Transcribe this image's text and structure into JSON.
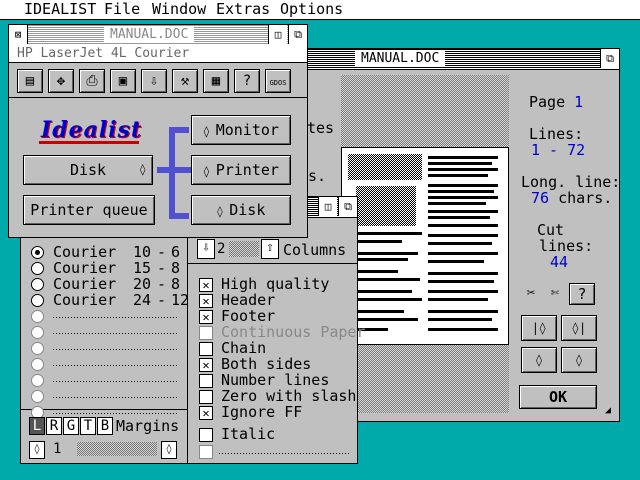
{
  "menu": {
    "items": [
      "IDEALIST",
      "File",
      "Window",
      "Extras",
      "Options"
    ]
  },
  "manual_window": {
    "title": "MANUAL.DOC",
    "page_label": "Page",
    "page_value": "1",
    "lines_label": "Lines:",
    "lines_value": "1 - 72",
    "long_label": "Long. line:",
    "long_value": "76",
    "long_unit": "chars.",
    "cut_label1": "Cut",
    "cut_label2": "lines:",
    "cut_value": "44",
    "help_label": "?",
    "ok_label": "OK",
    "behind_text1": "tes",
    "behind_text2": "D",
    "behind_text3": "rs."
  },
  "options_window": {
    "fonts": [
      {
        "name": "Courier",
        "size": "10",
        "dash": "-",
        "pitch": "6",
        "selected": true
      },
      {
        "name": "Courier",
        "size": "15",
        "dash": "-",
        "pitch": "8",
        "selected": false
      },
      {
        "name": "Courier",
        "size": "20",
        "dash": "-",
        "pitch": "8",
        "selected": false
      },
      {
        "name": "Courier",
        "size": "24",
        "dash": "-",
        "pitch": "12",
        "selected": false
      }
    ],
    "columns_value": "2",
    "columns_label": "Columns",
    "checks": [
      {
        "label": "High quality",
        "checked": true,
        "enabled": true
      },
      {
        "label": "Header",
        "checked": true,
        "enabled": true
      },
      {
        "label": "Footer",
        "checked": true,
        "enabled": true
      },
      {
        "label": "Continuous Paper",
        "checked": false,
        "enabled": false
      },
      {
        "label": "Chain",
        "checked": false,
        "enabled": true
      },
      {
        "label": "Both sides",
        "checked": true,
        "enabled": true
      },
      {
        "label": "Number lines",
        "checked": false,
        "enabled": true
      },
      {
        "label": "Zero with slash",
        "checked": false,
        "enabled": true
      },
      {
        "label": "Ignore FF",
        "checked": true,
        "enabled": true
      }
    ],
    "italic_label": "Italic",
    "margins": {
      "tabs": [
        "L",
        "R",
        "G",
        "T",
        "B"
      ],
      "label": "Margins",
      "value": "1"
    }
  },
  "printer_window": {
    "title": "MANUAL.DOC",
    "printer_name": "HP LaserJet 4L Courier",
    "logo": "Idealist",
    "monitor_label": "Monitor",
    "disk_label": "Disk",
    "printer_label": "Printer",
    "disk_out_label": "Disk",
    "queue_label": "Printer queue",
    "toolbar_icons": [
      "document-icon",
      "move-icon",
      "printer-icon",
      "page-setup-icon",
      "download-icon",
      "tools-icon",
      "print-settings-icon",
      "help-icon",
      "gdos-help-icon"
    ],
    "toolbar_help": "?",
    "toolbar_gdos": "GDOS"
  }
}
